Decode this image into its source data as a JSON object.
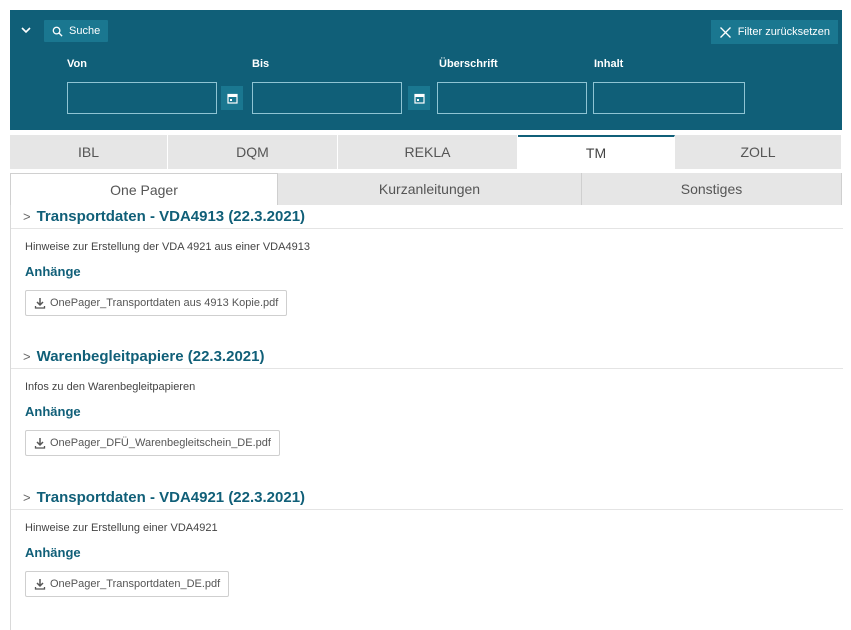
{
  "filter": {
    "search_label": "Suche",
    "reset_label": "Filter zurücksetzen",
    "fields": {
      "von": {
        "label": "Von",
        "value": ""
      },
      "bis": {
        "label": "Bis",
        "value": ""
      },
      "ueberschrift": {
        "label": "Überschrift",
        "value": ""
      },
      "inhalt": {
        "label": "Inhalt",
        "value": ""
      }
    }
  },
  "category_tabs": [
    {
      "label": "IBL"
    },
    {
      "label": "DQM"
    },
    {
      "label": "REKLA"
    },
    {
      "label": "TM",
      "active": true
    },
    {
      "label": "ZOLL"
    }
  ],
  "sub_tabs": [
    {
      "label": "One Pager",
      "active": true
    },
    {
      "label": "Kurzanleitungen"
    },
    {
      "label": "Sonstiges"
    }
  ],
  "sections": [
    {
      "title": "Transportdaten - VDA4913 (22.3.2021)",
      "description": "Hinweise zur Erstellung der VDA 4921 aus einer VDA4913",
      "attachments_label": "Anhänge",
      "file": "OnePager_Transportdaten aus 4913 Kopie.pdf"
    },
    {
      "title": "Warenbegleitpapiere (22.3.2021)",
      "description": "Infos zu den Warenbegleitpapieren",
      "attachments_label": "Anhänge",
      "file": "OnePager_DFÜ_Warenbegleitschein_DE.pdf"
    },
    {
      "title": "Transportdaten - VDA4921 (22.3.2021)",
      "description": "Hinweise zur Erstellung einer VDA4921",
      "attachments_label": "Anhänge",
      "file": "OnePager_Transportdaten_DE.pdf"
    }
  ],
  "icons": {
    "collapse": "chevron-down-icon",
    "search": "search-icon",
    "reset": "close-icon",
    "calendar": "calendar-icon",
    "section": "chevron-right-icon",
    "download": "download-icon"
  },
  "colors": {
    "panel": "#105f78",
    "accent": "#105f78",
    "tab_bg": "#e6e6e6"
  }
}
